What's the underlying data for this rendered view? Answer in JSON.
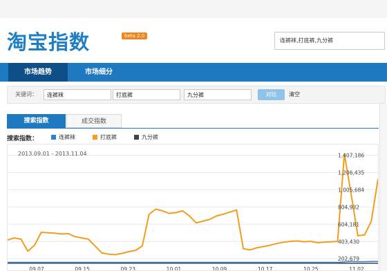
{
  "header": {
    "logo_text": "淘宝指数",
    "beta_badge": "beta 2.0",
    "search_value": "连裤袜,打底裤,九分裤"
  },
  "nav": {
    "tabs": [
      {
        "label": "市场趋势",
        "active": true
      },
      {
        "label": "市场细分",
        "active": false
      }
    ]
  },
  "filter": {
    "keyword_label": "关键词：",
    "keywords": [
      "连裤袜",
      "打底裤",
      "九分裤"
    ],
    "compare_label": "对比",
    "clear_label": "清空"
  },
  "subtabs": [
    {
      "label": "搜索指数",
      "active": true
    },
    {
      "label": "成交指数",
      "active": false
    }
  ],
  "legend": {
    "title": "搜索指数：",
    "items": [
      {
        "label": "连裤袜",
        "color": "#2f7ed8"
      },
      {
        "label": "打底裤",
        "color": "#f39c1e"
      },
      {
        "label": "九分裤",
        "color": "#444444"
      }
    ]
  },
  "chart_data": {
    "type": "line",
    "title": "",
    "date_range_label": "2013.09.01 - 2013.11.04",
    "xlabel": "",
    "ylabel": "",
    "y_ticks": [
      {
        "value": 202679,
        "label": "202,679"
      },
      {
        "value": 403430,
        "label": "403,430"
      },
      {
        "value": 604181,
        "label": "604,181"
      },
      {
        "value": 804932,
        "label": "804,932"
      },
      {
        "value": 1005684,
        "label": "1,005,684"
      },
      {
        "value": 1206435,
        "label": "1,206,435"
      },
      {
        "value": 1407186,
        "label": "1,407,186"
      }
    ],
    "x_ticks": [
      "09.07",
      "09.15",
      "09.23",
      "10.01",
      "10.09",
      "10.17",
      "10.25",
      "11.02"
    ],
    "ylim": [
      100000,
      1500000
    ],
    "grid": true,
    "series": [
      {
        "name": "打底裤",
        "color": "#f39c1e",
        "values": [
          420000,
          445000,
          430000,
          290000,
          360000,
          510000,
          505000,
          500000,
          490000,
          495000,
          460000,
          445000,
          430000,
          350000,
          270000,
          255000,
          250000,
          265000,
          285000,
          300000,
          350000,
          720000,
          780000,
          760000,
          730000,
          740000,
          760000,
          700000,
          620000,
          640000,
          660000,
          700000,
          720000,
          745000,
          770000,
          320000,
          305000,
          330000,
          345000,
          360000,
          380000,
          395000,
          405000,
          410000,
          400000,
          405000,
          390000,
          395000,
          400000,
          405000,
          1420000,
          960000,
          470000,
          480000,
          640000,
          1130000
        ]
      },
      {
        "name": "连裤袜",
        "color": "#2f7ed8",
        "values": [
          160000,
          160000,
          160000,
          160000,
          160000,
          160000,
          160000,
          160000,
          160000,
          160000,
          160000,
          160000,
          160000,
          160000,
          160000,
          160000,
          160000,
          160000,
          160000,
          160000,
          160000,
          160000,
          160000,
          160000,
          160000,
          160000,
          160000,
          160000,
          160000,
          160000,
          160000,
          160000,
          160000,
          160000,
          160000,
          160000,
          160000,
          160000,
          160000,
          160000,
          160000,
          160000,
          160000,
          160000,
          160000,
          160000,
          160000,
          160000,
          160000,
          160000,
          165000,
          170000,
          168000,
          168000,
          170000,
          172000
        ]
      },
      {
        "name": "九分裤",
        "color": "#444444",
        "values": [
          150000,
          150000,
          150000,
          150000,
          150000,
          150000,
          150000,
          150000,
          150000,
          150000,
          150000,
          150000,
          150000,
          150000,
          150000,
          150000,
          150000,
          150000,
          150000,
          150000,
          150000,
          150000,
          150000,
          150000,
          150000,
          150000,
          150000,
          150000,
          150000,
          150000,
          150000,
          150000,
          150000,
          150000,
          150000,
          150000,
          150000,
          150000,
          150000,
          150000,
          150000,
          150000,
          150000,
          150000,
          150000,
          150000,
          150000,
          150000,
          150000,
          150000,
          150000,
          150000,
          150000,
          150000,
          150000,
          150000
        ]
      }
    ]
  }
}
